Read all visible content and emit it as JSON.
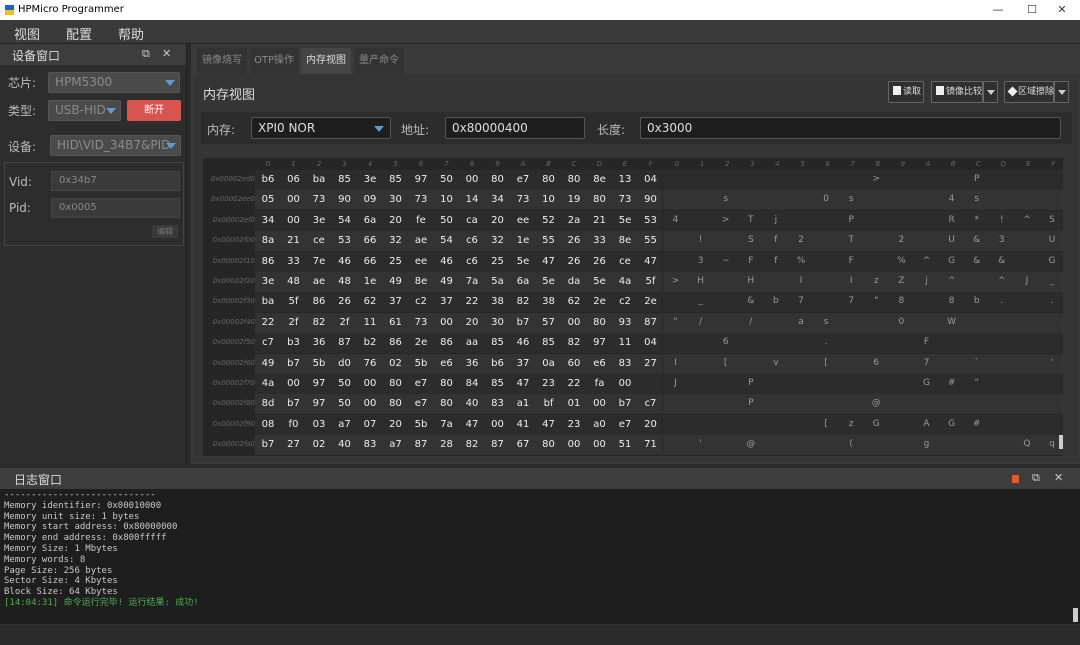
{
  "window": {
    "title": "HPMicro Programmer",
    "minimize": "—",
    "maximize": "☐",
    "close": "✕"
  },
  "menu": [
    "视图",
    "配置",
    "帮助"
  ],
  "device_window": {
    "title": "设备窗口",
    "chip_label": "芯片:",
    "chip_value": "HPM5300",
    "type_label": "类型:",
    "type_value": "USB-HID",
    "disconnect_label": "断开",
    "device_label": "设备:",
    "device_value": "HID\\VID_34B7&PID",
    "vid_label": "Vid:",
    "vid_value": "0x34b7",
    "pid_label": "Pid:",
    "pid_value": "0x0005",
    "edit_label": "编辑"
  },
  "tabs": [
    "镜像烧写",
    "OTP操作",
    "内存视图",
    "量产命令"
  ],
  "active_tab": 2,
  "memory_view": {
    "title": "内存视图",
    "read_label": "读取",
    "compare_label": "镜像比较",
    "erase_label": "区域擦除",
    "memory_label": "内存:",
    "memory_value": "XPI0 NOR",
    "address_label": "地址:",
    "address_value": "0x80000400",
    "length_label": "长度:",
    "length_value": "0x3000",
    "col_headers": [
      "0",
      "1",
      "2",
      "3",
      "4",
      "5",
      "6",
      "7",
      "8",
      "9",
      "A",
      "B",
      "C",
      "D",
      "E",
      "F"
    ],
    "rows": [
      {
        "addr": "0x00002ed0",
        "hex": [
          "b6",
          "06",
          "ba",
          "85",
          "3e",
          "85",
          "97",
          "50",
          "00",
          "80",
          "e7",
          "80",
          "80",
          "8e",
          "13",
          "04"
        ],
        "ascii": [
          "",
          "",
          "",
          "",
          "",
          "",
          "",
          "",
          ">",
          "",
          "",
          "",
          "P",
          "",
          "",
          "",
          ""
        ]
      },
      {
        "addr": "0x00002ee0",
        "hex": [
          "05",
          "00",
          "73",
          "90",
          "09",
          "30",
          "73",
          "10",
          "14",
          "34",
          "73",
          "10",
          "19",
          "80",
          "73",
          "90"
        ],
        "ascii": [
          "",
          "",
          "s",
          "",
          "",
          "",
          "0",
          "s",
          "",
          "",
          "",
          "4",
          "s",
          "",
          "",
          "",
          "s"
        ]
      },
      {
        "addr": "0x00002ef0",
        "hex": [
          "34",
          "00",
          "3e",
          "54",
          "6a",
          "20",
          "fe",
          "50",
          "ca",
          "20",
          "ee",
          "52",
          "2a",
          "21",
          "5e",
          "53"
        ],
        "ascii": [
          "4",
          "",
          ">",
          "T",
          "j",
          "",
          "",
          "P",
          "",
          "",
          "",
          "R",
          "*",
          "!",
          "^",
          "S"
        ]
      },
      {
        "addr": "0x00002f00",
        "hex": [
          "8a",
          "21",
          "ce",
          "53",
          "66",
          "32",
          "ae",
          "54",
          "c6",
          "32",
          "1e",
          "55",
          "26",
          "33",
          "8e",
          "55"
        ],
        "ascii": [
          "",
          "!",
          "",
          "S",
          "f",
          "2",
          "",
          "T",
          "",
          "2",
          "",
          "U",
          "&",
          "3",
          "",
          "U"
        ]
      },
      {
        "addr": "0x00002f10",
        "hex": [
          "86",
          "33",
          "7e",
          "46",
          "66",
          "25",
          "ee",
          "46",
          "c6",
          "25",
          "5e",
          "47",
          "26",
          "26",
          "ce",
          "47"
        ],
        "ascii": [
          "",
          "3",
          "~",
          "F",
          "f",
          "%",
          "",
          "F",
          "",
          "%",
          "^",
          "G",
          "&",
          "&",
          "",
          "G"
        ]
      },
      {
        "addr": "0x00002f20",
        "hex": [
          "3e",
          "48",
          "ae",
          "48",
          "1e",
          "49",
          "8e",
          "49",
          "7a",
          "5a",
          "6a",
          "5e",
          "da",
          "5e",
          "4a",
          "5f"
        ],
        "ascii": [
          ">",
          "H",
          "",
          "H",
          "",
          "I",
          "",
          "I",
          "z",
          "Z",
          "j",
          "^",
          "",
          "^",
          "J",
          "_"
        ]
      },
      {
        "addr": "0x00002f30",
        "hex": [
          "ba",
          "5f",
          "86",
          "26",
          "62",
          "37",
          "c2",
          "37",
          "22",
          "38",
          "82",
          "38",
          "62",
          "2e",
          "c2",
          "2e"
        ],
        "ascii": [
          "",
          "_",
          "",
          "&",
          "b",
          "7",
          "",
          "7",
          "\"",
          "8",
          "",
          "8",
          "b",
          ".",
          "",
          "."
        ]
      },
      {
        "addr": "0x00002f40",
        "hex": [
          "22",
          "2f",
          "82",
          "2f",
          "11",
          "61",
          "73",
          "00",
          "20",
          "30",
          "b7",
          "57",
          "00",
          "80",
          "93",
          "87"
        ],
        "ascii": [
          "\"",
          "/",
          "",
          "/",
          "",
          "a",
          "s",
          "",
          "",
          "0",
          "",
          "W",
          "",
          "",
          "",
          ""
        ]
      },
      {
        "addr": "0x00002f50",
        "hex": [
          "c7",
          "b3",
          "36",
          "87",
          "b2",
          "86",
          "2e",
          "86",
          "aa",
          "85",
          "46",
          "85",
          "82",
          "97",
          "11",
          "04"
        ],
        "ascii": [
          "",
          "",
          "6",
          "",
          "",
          "",
          ".",
          "",
          "",
          "",
          "F",
          "",
          "",
          "",
          "",
          ""
        ]
      },
      {
        "addr": "0x00002f60",
        "hex": [
          "49",
          "b7",
          "5b",
          "d0",
          "76",
          "02",
          "5b",
          "e6",
          "36",
          "b6",
          "37",
          "0a",
          "60",
          "e6",
          "83",
          "27"
        ],
        "ascii": [
          "I",
          "",
          "[",
          "",
          "v",
          "",
          "[",
          "",
          "6",
          "",
          "7",
          "",
          "`",
          "",
          "",
          "'"
        ]
      },
      {
        "addr": "0x00002f70",
        "hex": [
          "4a",
          "00",
          "97",
          "50",
          "00",
          "80",
          "e7",
          "80",
          "84",
          "85",
          "47",
          "23",
          "22",
          "fa",
          "00",
          ""
        ],
        "ascii": [
          "J",
          "",
          "",
          "P",
          "",
          "",
          "",
          "",
          "",
          "",
          "G",
          "#",
          "\"",
          "",
          "",
          ""
        ]
      },
      {
        "addr": "0x00002f80",
        "hex": [
          "8d",
          "b7",
          "97",
          "50",
          "00",
          "80",
          "e7",
          "80",
          "40",
          "83",
          "a1",
          "bf",
          "01",
          "00",
          "b7",
          "c7"
        ],
        "ascii": [
          "",
          "",
          "",
          "P",
          "",
          "",
          "",
          "",
          "@",
          "",
          "",
          "",
          "",
          "",
          "",
          ""
        ]
      },
      {
        "addr": "0x00002f90",
        "hex": [
          "08",
          "f0",
          "03",
          "a7",
          "07",
          "20",
          "5b",
          "7a",
          "47",
          "00",
          "41",
          "47",
          "23",
          "a0",
          "e7",
          "20"
        ],
        "ascii": [
          "",
          "",
          "",
          "",
          "",
          "",
          "[",
          "z",
          "G",
          "",
          "A",
          "G",
          "#",
          "",
          "",
          ""
        ]
      },
      {
        "addr": "0x00002fa0",
        "hex": [
          "b7",
          "27",
          "02",
          "40",
          "83",
          "a7",
          "87",
          "28",
          "82",
          "87",
          "67",
          "80",
          "00",
          "00",
          "51",
          "71"
        ],
        "ascii": [
          "",
          "'",
          "",
          "@",
          "",
          "",
          "",
          "(",
          "",
          "",
          "g",
          "",
          "",
          "",
          "Q",
          "q"
        ]
      }
    ]
  },
  "log_window": {
    "title": "日志窗口",
    "lines": [
      "----------------------------",
      "Memory identifier: 0x00010000",
      "Memory unit size: 1 bytes",
      "Memory start address: 0x80000000",
      "Memory end address: 0x800fffff",
      "Memory Size: 1 Mbytes",
      "Memory words: 8",
      "Page Size: 256 bytes",
      "Sector Size: 4 Kbytes",
      "Block Size: 64 Kbytes"
    ],
    "success_line": "[14:04:31] 命令运行完毕! 运行结果: 成功!"
  },
  "colors": {
    "accent": "#5b9bd5",
    "danger": "#d9534f",
    "success": "#4caf50"
  }
}
